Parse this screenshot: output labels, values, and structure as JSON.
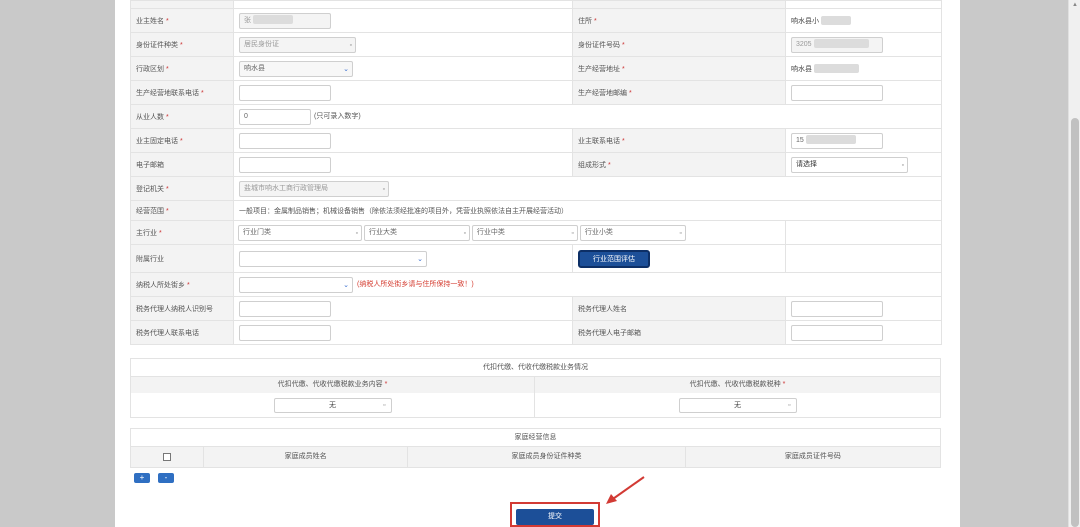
{
  "form": {
    "rows": [
      {
        "l1": "业主姓名",
        "v1": "张",
        "l2": "住所",
        "v2": "响水县小"
      },
      {
        "l1": "身份证件种类",
        "v1": "居民身份证",
        "l2": "身份证件号码",
        "v2": "3205"
      },
      {
        "l1": "行政区划",
        "v1": "响水县",
        "l2": "生产经营地址",
        "v2": "响水县"
      },
      {
        "l1": "生产经营地联系电话",
        "v1": "",
        "l2": "生产经营地邮编",
        "v2": ""
      },
      {
        "l1": "从业人数",
        "v1": "0",
        "hint": "(只可录入数字)"
      },
      {
        "l1": "业主固定电话",
        "v1": "",
        "l2": "业主联系电话",
        "v2": "15"
      },
      {
        "l1": "电子邮箱",
        "v1": "",
        "l2": "组成形式",
        "v2": "请选择"
      },
      {
        "l1": "登记机关",
        "v1": "盐城市响水工商行政管理局"
      },
      {
        "l1": "经营范围",
        "v1": "一般项目：金属制品销售；机械设备销售（除依法须经批准的项目外，凭营业执照依法自主开展经营活动）"
      },
      {
        "l1": "主行业",
        "industry": [
          "行业门类",
          "行业大类",
          "行业中类",
          "行业小类"
        ]
      },
      {
        "l1": "附属行业",
        "v1": "",
        "btn": "行业范围评估"
      },
      {
        "l1": "纳税人所处街乡",
        "v1": "",
        "hint": "(纳税人所处街乡请与住所保持一致！)"
      },
      {
        "l1": "税务代理人纳税人识别号",
        "v1": "",
        "l2": "税务代理人姓名",
        "v2": ""
      },
      {
        "l1": "税务代理人联系电话",
        "v1": "",
        "l2": "税务代理人电子邮箱",
        "v2": ""
      }
    ],
    "required_marker": "*"
  },
  "withholding": {
    "title": "代扣代缴、代收代缴税款业务情况",
    "col1": "代扣代缴、代收代缴税款业务内容",
    "col2": "代扣代缴、代收代缴税款税种",
    "val1": "无",
    "val2": "无"
  },
  "family": {
    "title": "家庭经营信息",
    "cols": [
      "家庭成员姓名",
      "家庭成员身份证件种类",
      "家庭成员证件号码"
    ]
  },
  "buttons": {
    "add": "+",
    "remove": "-",
    "submit": "提交"
  },
  "colors": {
    "accent": "#1c4f98",
    "highlight": "#d23a34"
  }
}
